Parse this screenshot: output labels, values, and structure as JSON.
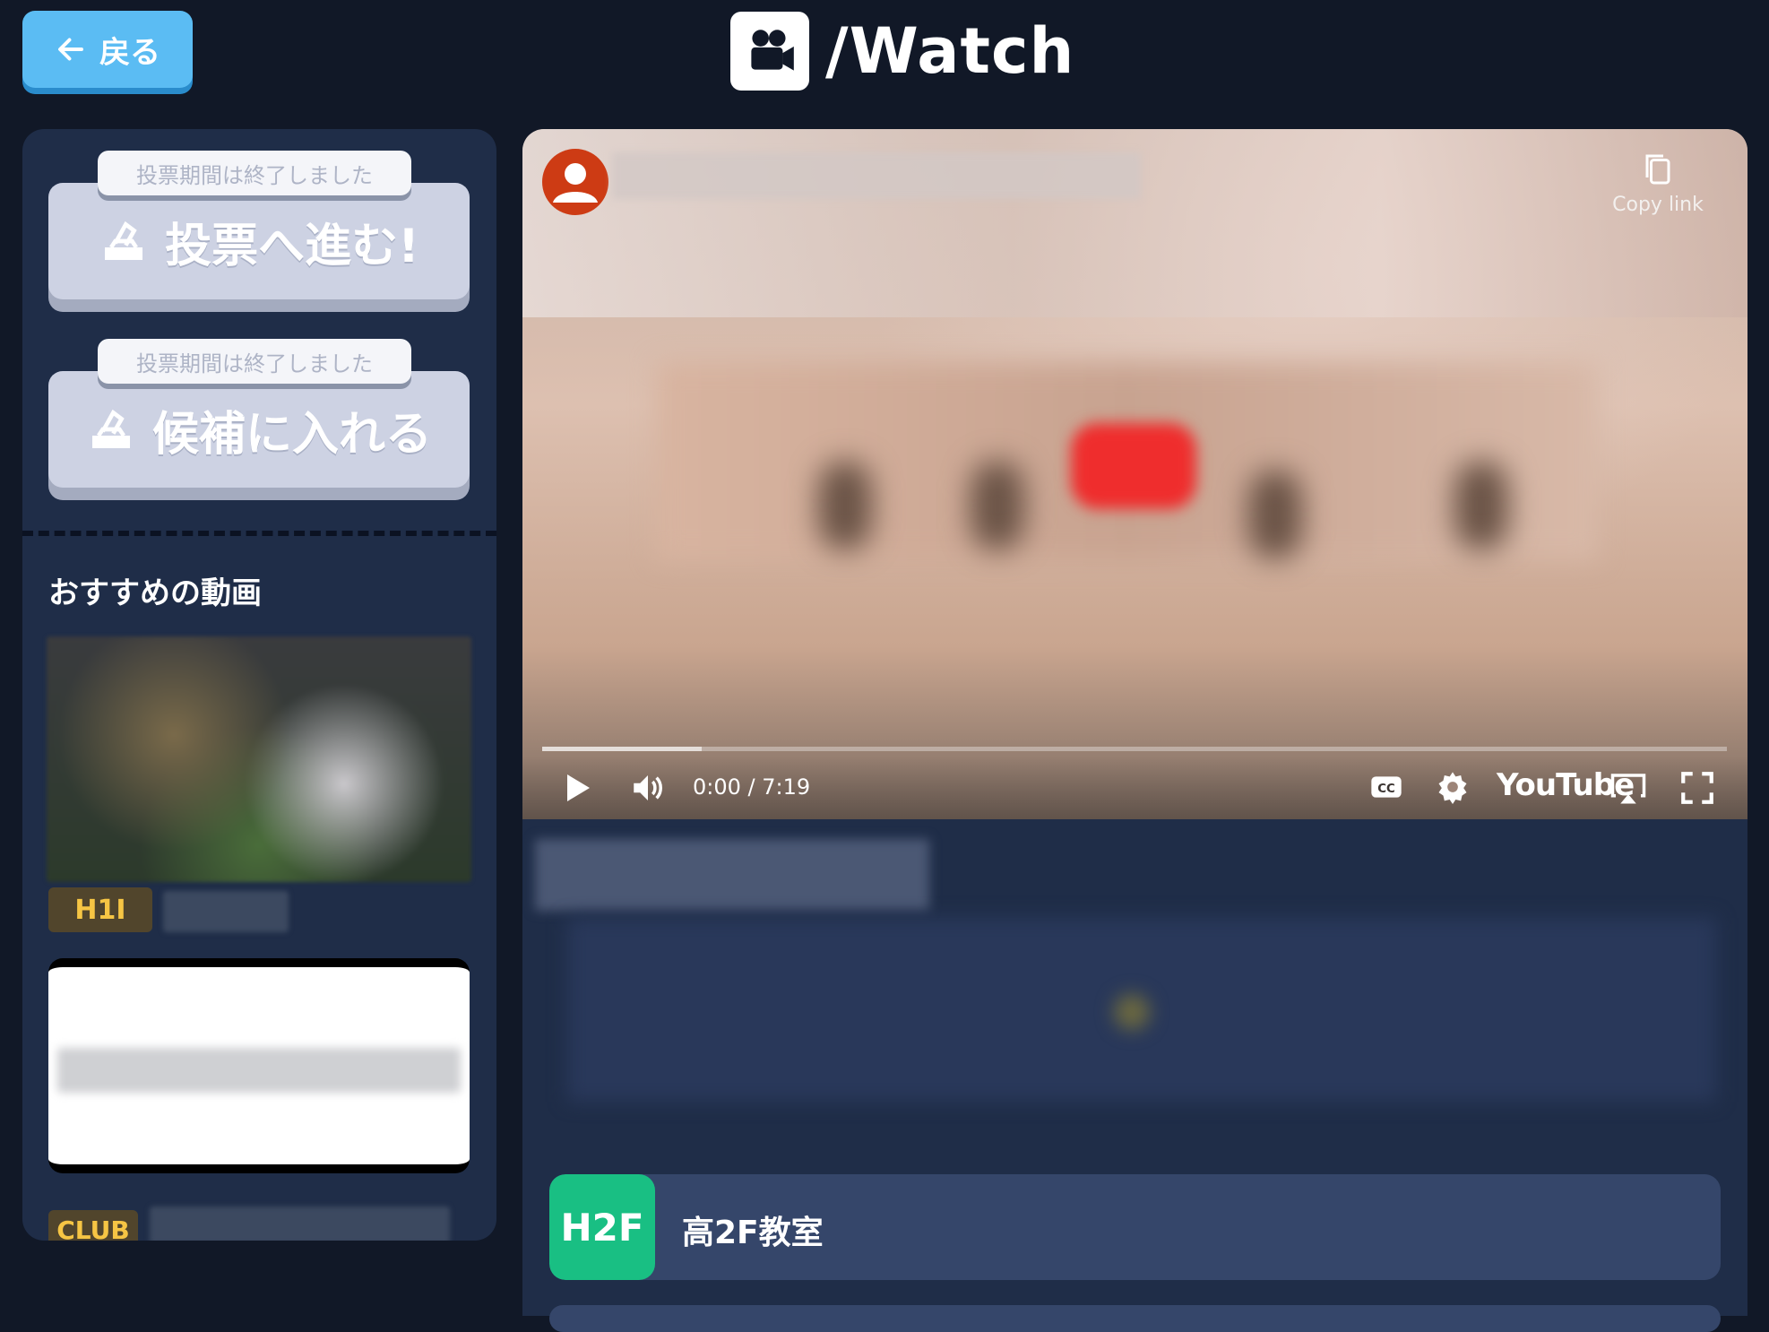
{
  "header": {
    "back_label": "戻る",
    "page_title": "/Watch"
  },
  "sidebar": {
    "vote_tag": "投票期間は終了しました",
    "vote_button": "投票へ進む!",
    "candidate_tag": "投票期間は終了しました",
    "candidate_button": "候補に入れる",
    "recommend_heading": "おすすめの動画",
    "videos": [
      {
        "badge": "H1I"
      },
      {
        "badge": "CLUB"
      }
    ]
  },
  "player": {
    "copy_link": "Copy link",
    "time": "0:00 / 7:19",
    "brand": "YouTube",
    "progress_fraction": 0.135
  },
  "location": {
    "badge": "H2F",
    "label": "高2F教室"
  },
  "colors": {
    "background": "#111827",
    "panel": "#1f2d48",
    "back_button": "#5bbcf3",
    "location_badge": "#19bf83",
    "badge_text": "#f6c544"
  }
}
